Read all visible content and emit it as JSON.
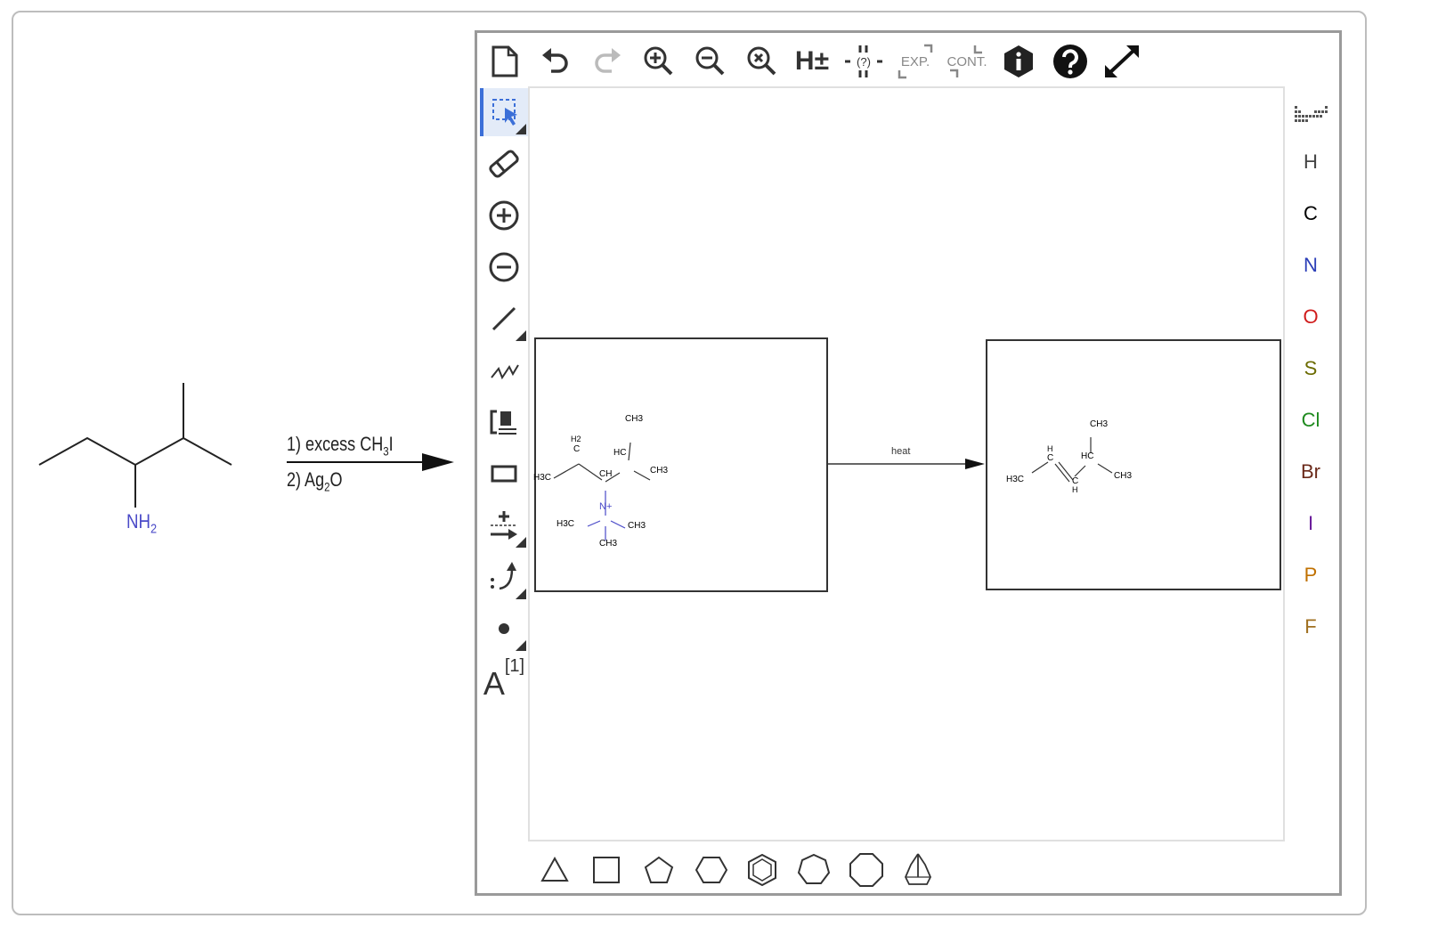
{
  "question": {
    "reactant_label": "NH",
    "reactant_label_sub": "2",
    "reagent_line1_prefix": "1) excess CH",
    "reagent_line1_sub": "3",
    "reagent_line1_suffix": "I",
    "reagent_line2_prefix": "2) Ag",
    "reagent_line2_sub": "2",
    "reagent_line2_suffix": "O"
  },
  "toolbar": {
    "h_toggle": "H±",
    "generic_label": "(?)",
    "expand_label": "EXP.",
    "contract_label": "CONT."
  },
  "left_tools": {
    "text_tool": "A",
    "text_tool_sup": "[1]"
  },
  "canvas": {
    "arrow_label": "heat",
    "mol1": {
      "ch3_top": "CH3",
      "h2": "H2",
      "c": "C",
      "hc": "HC",
      "ch3_right": "CH3",
      "h3c_left": "H3C",
      "ch": "CH",
      "n_plus": "N+",
      "h3c_n": "H3C",
      "ch3_n_right": "CH3",
      "ch3_n_bottom": "CH3"
    },
    "mol2": {
      "ch3_top": "CH3",
      "h_top": "H",
      "c1": "C",
      "hc": "HC",
      "ch3_right": "CH3",
      "h3c": "H3C",
      "c2": "C",
      "h_bottom": "H"
    }
  },
  "elements": [
    {
      "symbol": "H",
      "color": "#444444"
    },
    {
      "symbol": "C",
      "color": "#000000"
    },
    {
      "symbol": "N",
      "color": "#2c3fb8"
    },
    {
      "symbol": "O",
      "color": "#d01c1c"
    },
    {
      "symbol": "S",
      "color": "#6b6b00"
    },
    {
      "symbol": "Cl",
      "color": "#1e8a1e"
    },
    {
      "symbol": "Br",
      "color": "#6b2a1a"
    },
    {
      "symbol": "I",
      "color": "#6a1b9a"
    },
    {
      "symbol": "P",
      "color": "#c07000"
    },
    {
      "symbol": "F",
      "color": "#a07020"
    }
  ],
  "colors": {
    "accent": "#3b6fd8",
    "nitrogen": "#4a4ac8"
  }
}
